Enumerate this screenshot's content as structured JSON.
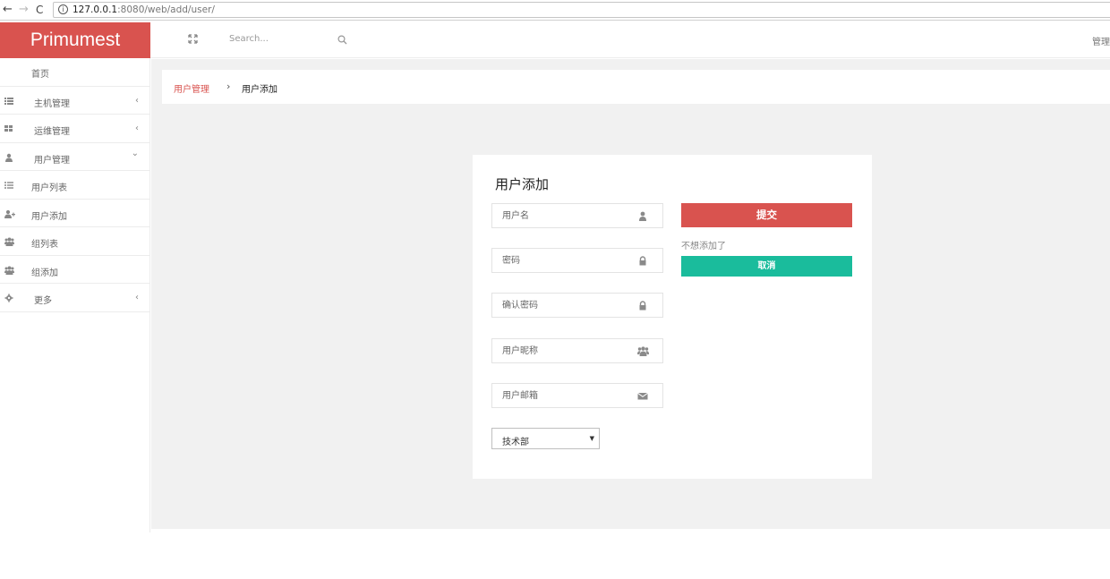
{
  "browser": {
    "url_host": "127.0.0.1",
    "url_rest": ":8080/web/add/user/"
  },
  "brand": "Primumest",
  "topbar": {
    "search_placeholder": "Search...",
    "right_label": "管理"
  },
  "sidebar": {
    "items": [
      {
        "label": "首页",
        "icon": "",
        "chevron": ""
      },
      {
        "label": "主机管理",
        "icon": "list-icon",
        "chevron": "‹"
      },
      {
        "label": "运维管理",
        "icon": "grid-icon",
        "chevron": "‹"
      },
      {
        "label": "用户管理",
        "icon": "user-icon",
        "chevron": "⌄"
      },
      {
        "label": "用户列表",
        "icon": "list-ul-icon",
        "chevron": ""
      },
      {
        "label": "用户添加",
        "icon": "user-plus-icon",
        "chevron": ""
      },
      {
        "label": "组列表",
        "icon": "users-icon",
        "chevron": ""
      },
      {
        "label": "组添加",
        "icon": "users-icon",
        "chevron": ""
      },
      {
        "label": "更多",
        "icon": "gear-icon",
        "chevron": "‹"
      }
    ]
  },
  "breadcrumb": {
    "parent": "用户管理",
    "separator": "›",
    "current": "用户添加"
  },
  "form": {
    "title": "用户添加",
    "fields": [
      {
        "placeholder": "用户名",
        "icon": "user-icon"
      },
      {
        "placeholder": "密码",
        "icon": "lock-icon"
      },
      {
        "placeholder": "确认密码",
        "icon": "lock-icon"
      },
      {
        "placeholder": "用户昵称",
        "icon": "users-icon"
      },
      {
        "placeholder": "用户邮箱",
        "icon": "envelope-icon"
      }
    ],
    "group_select": "技术部",
    "submit_label": "提交",
    "note": "不想添加了",
    "cancel_label": "取消"
  },
  "colors": {
    "brand": "#d9534f",
    "cancel": "#1abc9c"
  }
}
